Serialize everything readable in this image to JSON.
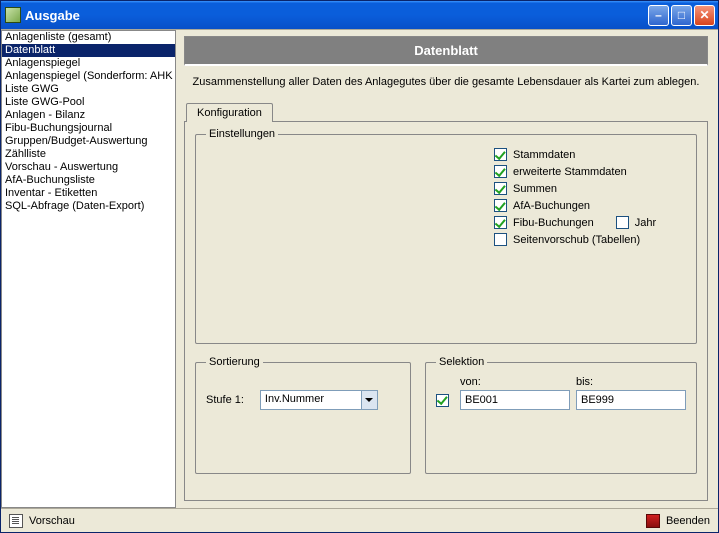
{
  "window": {
    "title": "Ausgabe"
  },
  "sidebar": {
    "items": [
      {
        "label": "Anlagenliste (gesamt)"
      },
      {
        "label": "Datenblatt",
        "selected": true
      },
      {
        "label": "Anlagenspiegel"
      },
      {
        "label": "Anlagenspiegel (Sonderform: AHK und"
      },
      {
        "label": "Liste GWG"
      },
      {
        "label": "Liste GWG-Pool"
      },
      {
        "label": "Anlagen - Bilanz"
      },
      {
        "label": "Fibu-Buchungsjournal"
      },
      {
        "label": "Gruppen/Budget-Auswertung"
      },
      {
        "label": "Zählliste"
      },
      {
        "label": "Vorschau - Auswertung"
      },
      {
        "label": "AfA-Buchungsliste"
      },
      {
        "label": "Inventar - Etiketten"
      },
      {
        "label": "SQL-Abfrage (Daten-Export)"
      }
    ]
  },
  "main": {
    "header": "Datenblatt",
    "description": "Zusammenstellung aller Daten des Anlagegutes über die gesamte Lebensdauer als Kartei zum ablegen.",
    "tab": "Konfiguration",
    "settings": {
      "legend": "Einstellungen",
      "checks": [
        {
          "label": "Stammdaten",
          "checked": true
        },
        {
          "label": "erweiterte Stammdaten",
          "checked": true
        },
        {
          "label": "Summen",
          "checked": true
        },
        {
          "label": "AfA-Buchungen",
          "checked": true
        },
        {
          "label": "Fibu-Buchungen",
          "checked": true,
          "sub": {
            "label": "Jahr",
            "checked": false
          }
        },
        {
          "label": "Seitenvorschub (Tabellen)",
          "checked": false
        }
      ]
    },
    "sort": {
      "legend": "Sortierung",
      "label": "Stufe 1:",
      "value": "Inv.Nummer"
    },
    "selection": {
      "legend": "Selektion",
      "enabled": true,
      "from_label": "von:",
      "to_label": "bis:",
      "from_value": "BE001",
      "to_value": "BE999"
    }
  },
  "statusbar": {
    "preview": "Vorschau",
    "close": "Beenden"
  }
}
